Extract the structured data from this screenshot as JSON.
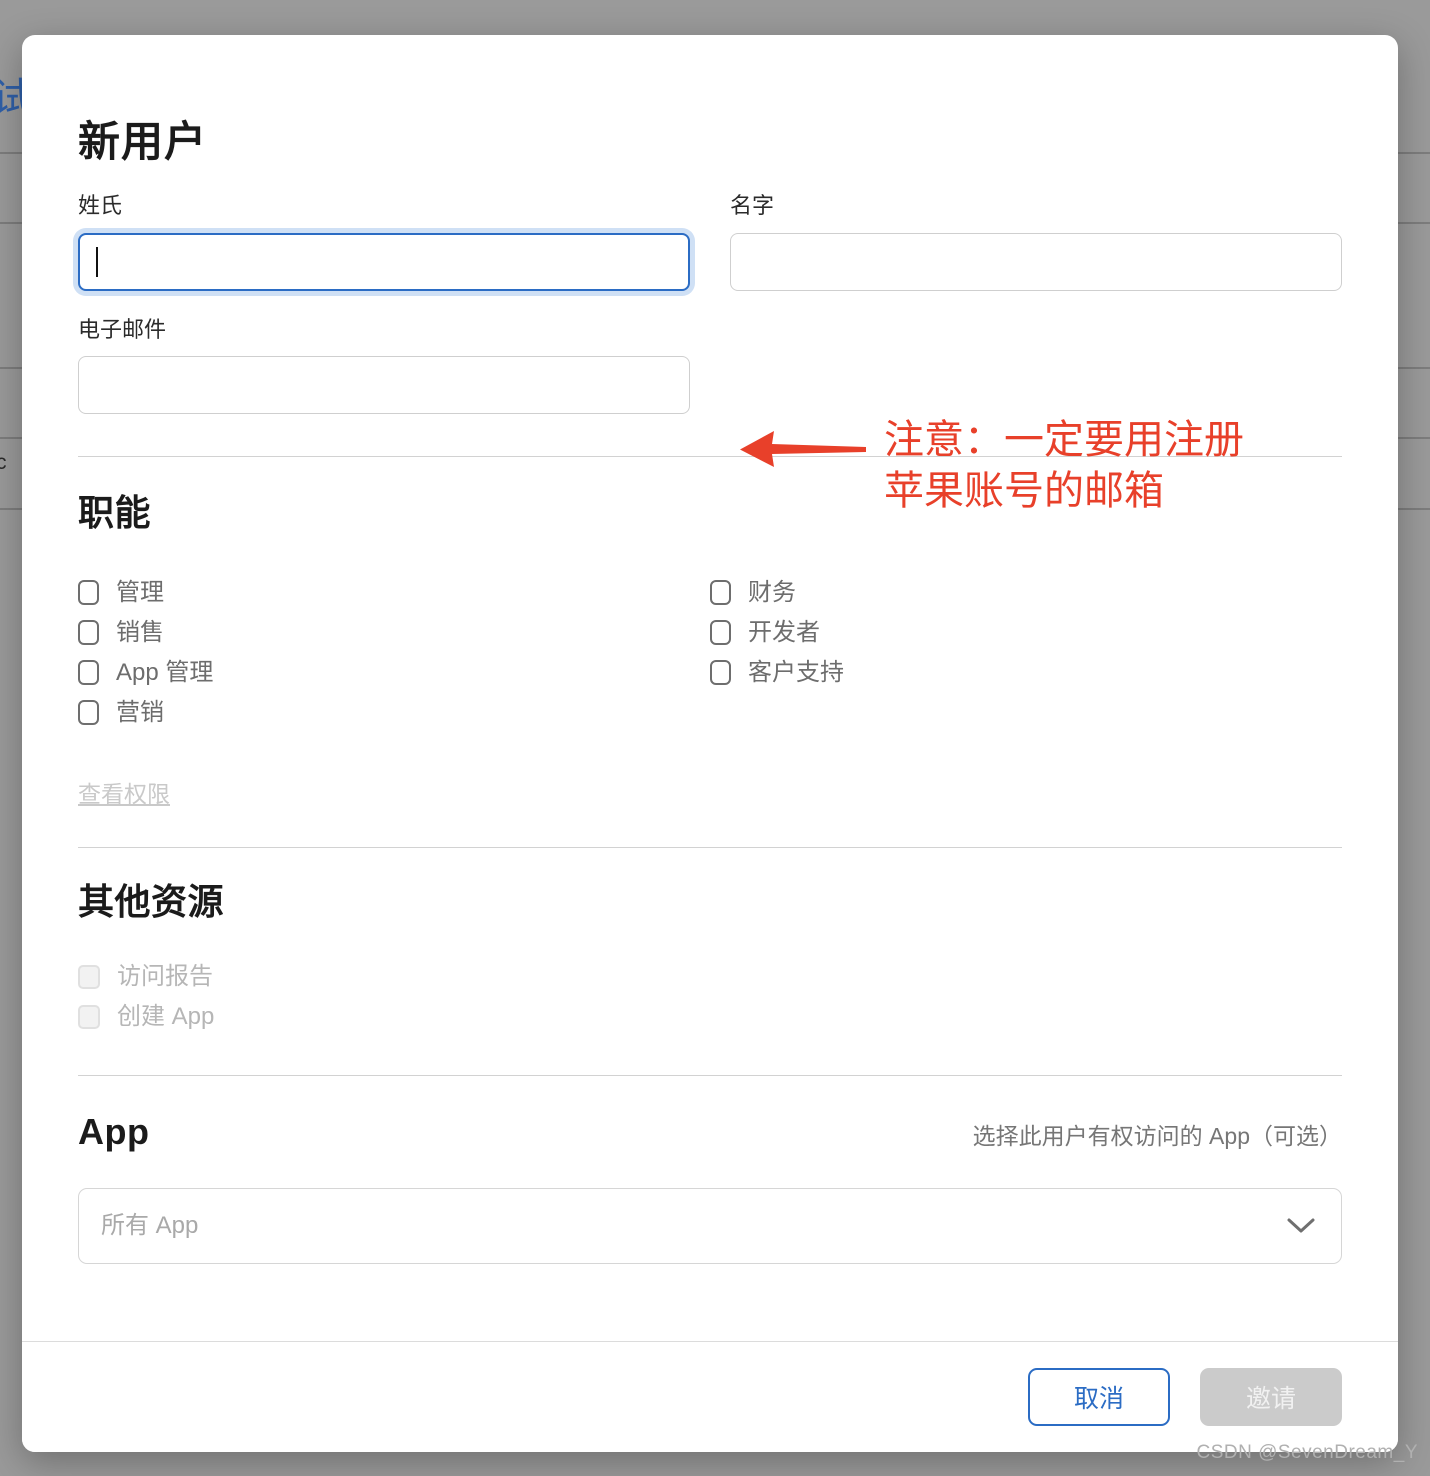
{
  "background": {
    "blue_fragment": "试",
    "text_fragment": "c"
  },
  "modal": {
    "title": "新用户",
    "name_fields": {
      "last_name": {
        "label": "姓氏",
        "value": "",
        "placeholder": ""
      },
      "first_name": {
        "label": "名字",
        "value": "",
        "placeholder": ""
      }
    },
    "email_field": {
      "label": "电子邮件",
      "value": "",
      "placeholder": ""
    },
    "annotation": {
      "text": "注意：一定要用注册\n苹果账号的邮箱",
      "color": "#e8402a",
      "arrow": "left-arrow"
    },
    "roles": {
      "title": "职能",
      "left_column": [
        {
          "label": "管理",
          "checked": false
        },
        {
          "label": "销售",
          "checked": false
        },
        {
          "label": "App 管理",
          "checked": false
        },
        {
          "label": "营销",
          "checked": false
        }
      ],
      "right_column": [
        {
          "label": "财务",
          "checked": false
        },
        {
          "label": "开发者",
          "checked": false
        },
        {
          "label": "客户支持",
          "checked": false
        }
      ],
      "permissions_link": "查看权限"
    },
    "other_resources": {
      "title": "其他资源",
      "items": [
        {
          "label": "访问报告",
          "checked": false,
          "disabled": true
        },
        {
          "label": "创建 App",
          "checked": false,
          "disabled": true
        }
      ]
    },
    "app_section": {
      "title": "App",
      "hint": "选择此用户有权访问的 App（可选）",
      "select": {
        "value": "所有 App",
        "icon": "chevron-down-icon"
      }
    },
    "footer": {
      "cancel_label": "取消",
      "invite_label": "邀请",
      "invite_disabled": true
    }
  },
  "watermark": "CSDN @SevenDream_Y"
}
